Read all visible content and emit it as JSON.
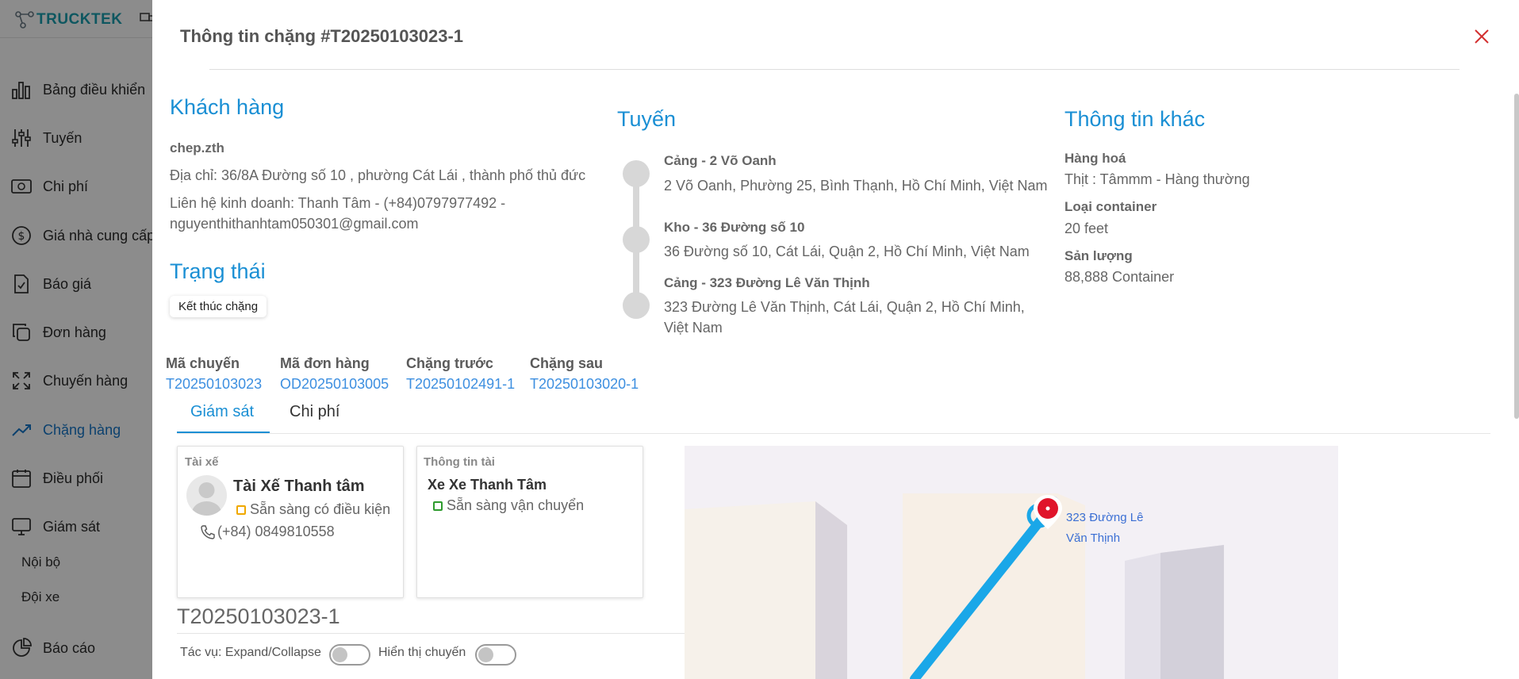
{
  "app": {
    "logo_text": "TRUCKTEK"
  },
  "sidebar": {
    "items": [
      {
        "label": "Bảng điều khiển",
        "icon": "bar-chart-icon"
      },
      {
        "label": "Tuyến",
        "icon": "sliders-icon"
      },
      {
        "label": "Chi phí",
        "icon": "money-icon"
      },
      {
        "label": "Giá nhà cung cấp",
        "icon": "dollar-circle-icon"
      },
      {
        "label": "Báo giá",
        "icon": "document-check-icon"
      },
      {
        "label": "Đơn hàng",
        "icon": "copy-icon"
      },
      {
        "label": "Chuyến hàng",
        "icon": "expand-icon"
      },
      {
        "label": "Chặng hàng",
        "icon": "trend-icon",
        "active": true
      },
      {
        "label": "Điều phối",
        "icon": "calendar-icon"
      },
      {
        "label": "Giám sát",
        "icon": "monitor-icon"
      },
      {
        "label": "Báo cáo",
        "icon": "pie-chart-icon"
      }
    ],
    "sub_items": [
      "Nội bộ",
      "Đội xe"
    ]
  },
  "drawer": {
    "title": "Thông tin chặng #T20250103023-1"
  },
  "customer": {
    "heading": "Khách hàng",
    "name": "chep.zth",
    "address": "Địa chỉ: 36/8A Đường số 10 , phường Cát Lái , thành phố thủ đức",
    "contact_line1": "Liên hệ kinh doanh: Thanh Tâm - (+84)0797977492 -",
    "contact_line2": "nguyenthithanhtam050301@gmail.com"
  },
  "status": {
    "heading": "Trạng thái",
    "value": "Kết thúc chặng"
  },
  "route": {
    "heading": "Tuyến",
    "stops": [
      {
        "name": "Cảng - 2 Võ Oanh",
        "address_line1": "2 Võ Oanh, Phường 25, Bình Thạnh, Hồ Chí Minh, Việt Nam",
        "address_line2": ""
      },
      {
        "name": "Kho - 36 Đường số 10",
        "address_line1": "36 Đường số 10, Cát Lái, Quận 2, Hồ Chí Minh, Việt Nam",
        "address_line2": ""
      },
      {
        "name": "Cảng - 323 Đường Lê Văn Thịnh",
        "address_line1": "323 Đường Lê Văn Thịnh, Cát Lái, Quận 2, Hồ Chí Minh,",
        "address_line2": "Việt Nam"
      }
    ]
  },
  "other_info": {
    "heading": "Thông tin khác",
    "cargo_label": "Hàng hoá",
    "cargo_value": "Thịt : Tâmmm - Hàng thường",
    "container_label": "Loại container",
    "container_value": "20 feet",
    "volume_label": "Sản lượng",
    "volume_value": "88,888 Container"
  },
  "refs": {
    "trip_label": "Mã chuyến",
    "trip_value": "T20250103023",
    "order_label": "Mã đơn hàng",
    "order_value": "OD20250103005",
    "prev_label": "Chặng trước",
    "prev_value": "T20250102491-1",
    "next_label": "Chặng sau",
    "next_value": "T20250103020-1"
  },
  "tabs": [
    {
      "label": "Giám sát",
      "active": true
    },
    {
      "label": "Chi phí",
      "active": false
    }
  ],
  "driver_card": {
    "label": "Tài xế",
    "name": "Tài Xế Thanh tâm",
    "status": "Sẵn sàng có điều kiện",
    "status_color": "#f0a800",
    "phone": "(+84) 0849810558"
  },
  "vehicle_card": {
    "label": "Thông tin tài",
    "name": "Xe Xe Thanh Tâm",
    "status": "Sẵn sàng vận chuyển",
    "status_color": "#2e9b2e"
  },
  "leg_code": "T20250103023-1",
  "toggles": {
    "expand_label": "Tác vụ: Expand/Collapse",
    "show_trip_label": "Hiển thị chuyến"
  },
  "map": {
    "marker_label_line1": "323 Đường Lê",
    "marker_label_line2": "Văn Thịnh"
  },
  "colors": {
    "accent": "#1a8fd4",
    "link": "#3d8fe0",
    "route_line": "#1aa7e8",
    "marker": "#e0142a"
  }
}
